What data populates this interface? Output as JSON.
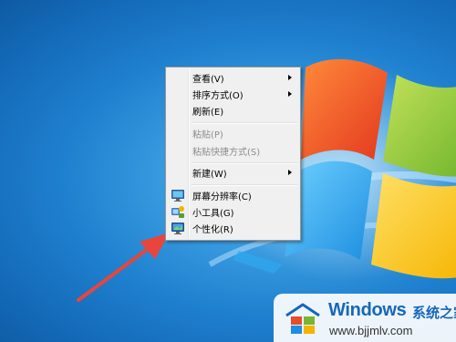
{
  "context_menu": {
    "items": [
      {
        "label": "查看(V)",
        "submenu": true,
        "enabled": true
      },
      {
        "label": "排序方式(O)",
        "submenu": true,
        "enabled": true
      },
      {
        "label": "刷新(E)",
        "submenu": false,
        "enabled": true
      },
      {
        "label": "粘贴(P)",
        "submenu": false,
        "enabled": false
      },
      {
        "label": "粘贴快捷方式(S)",
        "submenu": false,
        "enabled": false
      },
      {
        "label": "新建(W)",
        "submenu": true,
        "enabled": true
      },
      {
        "label": "屏幕分辨率(C)",
        "icon": "monitor-resolution-icon",
        "enabled": true
      },
      {
        "label": "小工具(G)",
        "icon": "gadgets-icon",
        "enabled": true
      },
      {
        "label": "个性化(R)",
        "icon": "personalize-icon",
        "enabled": true
      }
    ]
  },
  "annotation": {
    "color": "#e8453c"
  },
  "watermark": {
    "title": "Windows",
    "subtitle_cn": "系统之家",
    "url": "www.bjjmlv.com",
    "color": "#1667b8"
  },
  "colors": {
    "desktop_blue": "#1f80cf",
    "menu_bg": "#f0f0f0",
    "menu_border": "#979797",
    "disabled_text": "#8d8d8d"
  }
}
